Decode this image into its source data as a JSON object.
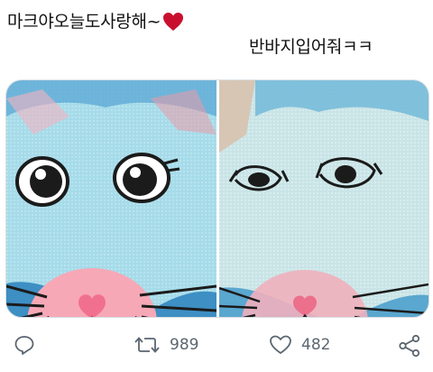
{
  "tweet": {
    "line1": "마크야오늘도사랑해~",
    "line2": "반바지입어줘ㅋㅋ"
  },
  "media": {
    "left_photo": "cat-face-sock-new",
    "right_photo": "cat-face-sock-worn",
    "colors": {
      "fabric": "#9ed6e6",
      "nose": "#f2708f",
      "muzzle": "#f6a8b6",
      "outline": "#1b1b1b"
    }
  },
  "actions": {
    "reply_icon": "reply-icon",
    "retweet_icon": "retweet-icon",
    "retweet_count": "989",
    "like_icon": "heart-icon",
    "like_count": "482",
    "share_icon": "share-icon"
  }
}
